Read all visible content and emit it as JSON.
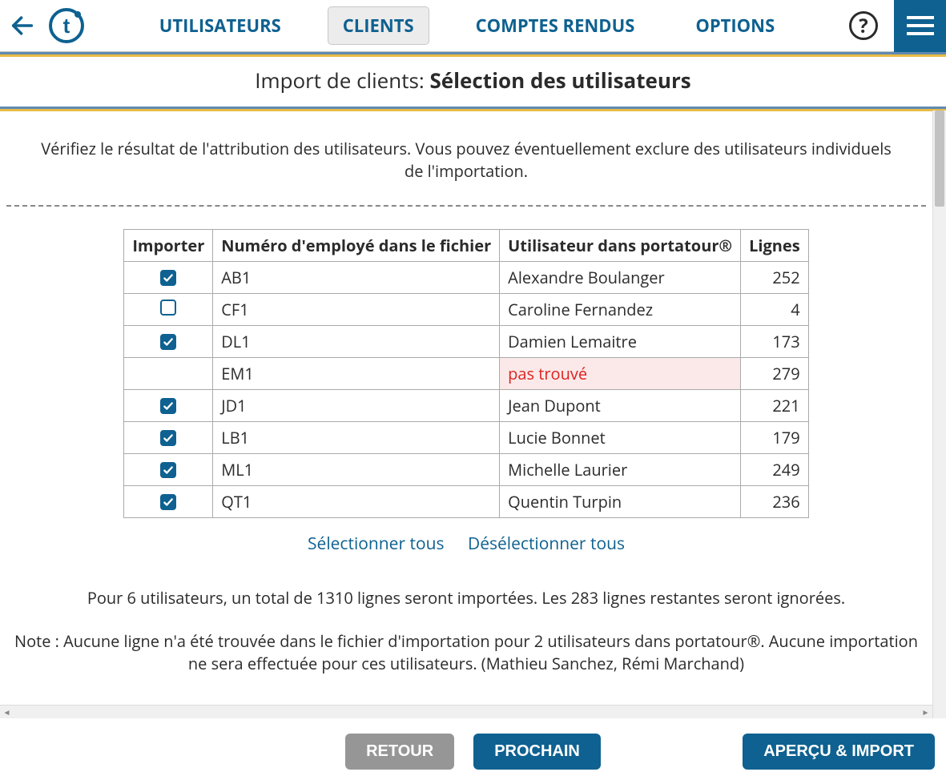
{
  "nav": {
    "items": [
      {
        "label": "UTILISATEURS"
      },
      {
        "label": "CLIENTS"
      },
      {
        "label": "COMPTES RENDUS"
      },
      {
        "label": "OPTIONS"
      }
    ],
    "active_index": 1,
    "help_label": "?"
  },
  "title": {
    "prefix": "Import de clients: ",
    "bold": "Sélection des utilisateurs"
  },
  "intro": "Vérifiez le résultat de l'attribution des utilisateurs. Vous pouvez éventuellement exclure des utilisateurs individuels de l'importation.",
  "table": {
    "headers": {
      "import": "Importer",
      "employee": "Numéro d'employé dans le fichier",
      "user": "Utilisateur dans portatour®",
      "lines": "Lignes"
    },
    "rows": [
      {
        "checked": true,
        "has_checkbox": true,
        "employee": "AB1",
        "user": "Alexandre Boulanger",
        "lines": 252,
        "error": false
      },
      {
        "checked": false,
        "has_checkbox": true,
        "employee": "CF1",
        "user": "Caroline Fernandez",
        "lines": 4,
        "error": false
      },
      {
        "checked": true,
        "has_checkbox": true,
        "employee": "DL1",
        "user": "Damien Lemaitre",
        "lines": 173,
        "error": false
      },
      {
        "checked": false,
        "has_checkbox": false,
        "employee": "EM1",
        "user": "pas trouvé",
        "lines": 279,
        "error": true
      },
      {
        "checked": true,
        "has_checkbox": true,
        "employee": "JD1",
        "user": "Jean Dupont",
        "lines": 221,
        "error": false
      },
      {
        "checked": true,
        "has_checkbox": true,
        "employee": "LB1",
        "user": "Lucie Bonnet",
        "lines": 179,
        "error": false
      },
      {
        "checked": true,
        "has_checkbox": true,
        "employee": "ML1",
        "user": "Michelle Laurier",
        "lines": 249,
        "error": false
      },
      {
        "checked": true,
        "has_checkbox": true,
        "employee": "QT1",
        "user": "Quentin Turpin",
        "lines": 236,
        "error": false
      }
    ]
  },
  "links": {
    "select_all": "Sélectionner tous",
    "deselect_all": "Désélectionner tous"
  },
  "summary": "Pour 6 utilisateurs, un total de 1310 lignes seront importées. Les 283 lignes restantes seront ignorées.",
  "note": "Note : Aucune ligne n'a été trouvée dans le fichier d'importation pour 2 utilisateurs dans portatour®. Aucune importation ne sera effectuée pour ces utilisateurs. (Mathieu Sanchez, Rémi Marchand)",
  "footer": {
    "back": "RETOUR",
    "next": "PROCHAIN",
    "preview": "APERÇU & IMPORT"
  }
}
